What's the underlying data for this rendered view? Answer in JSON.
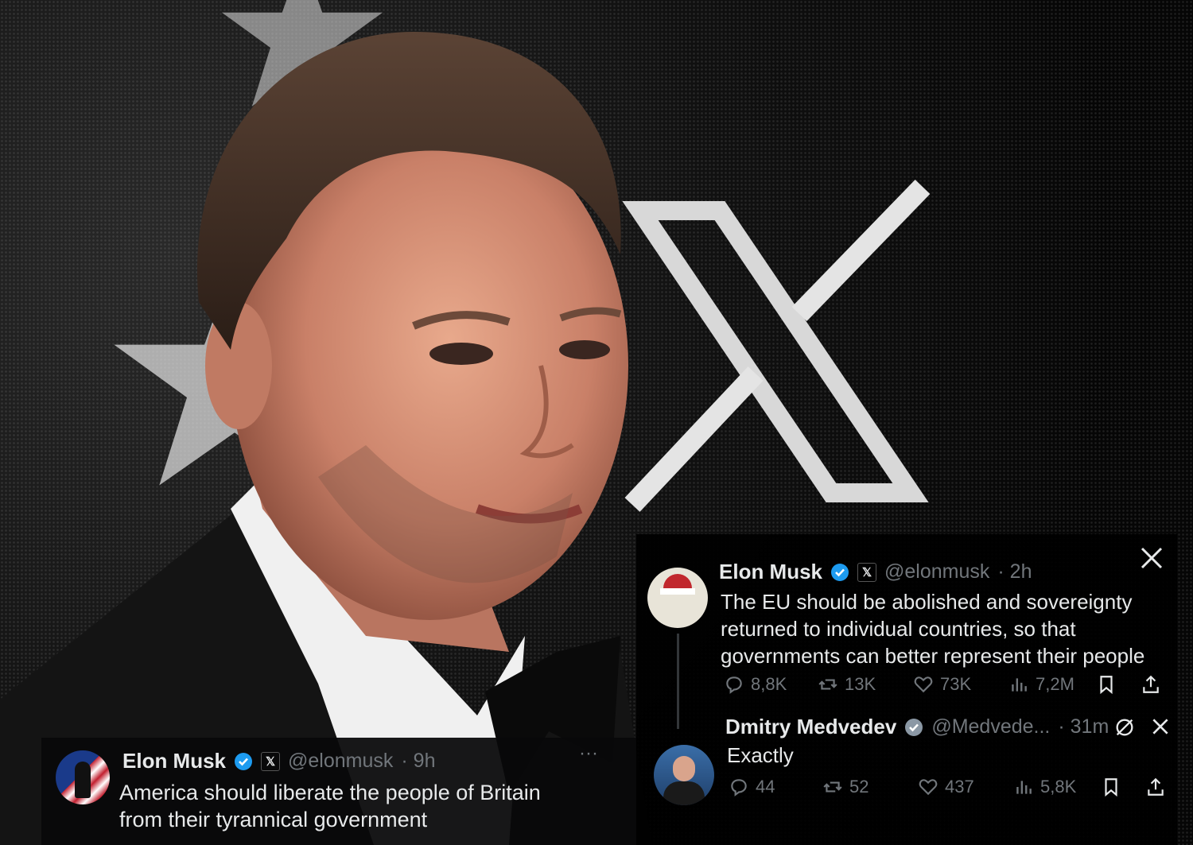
{
  "background": {
    "logo_icon": "x-logo-icon",
    "decor_icon": "star-icon"
  },
  "tweet_bottom": {
    "name": "Elon Musk",
    "handle": "@elonmusk",
    "time": "· 9h",
    "more": "···",
    "text_line1": "America should liberate the people of Britain",
    "text_line2": "from their tyrannical government"
  },
  "tweet_main": {
    "name": "Elon Musk",
    "handle": "@elonmusk",
    "time": "· 2h",
    "text_line1": "The EU should be abolished and sovereignty",
    "text_line2": "returned to individual countries, so that",
    "text_line3": "governments can better represent their people",
    "replies": "8,8K",
    "retweets": "13K",
    "likes": "73K",
    "views": "7,2M"
  },
  "tweet_reply": {
    "name": "Dmitry Medvedev",
    "handle": "@Medvede...",
    "time": "· 31m",
    "text": "Exactly",
    "replies": "44",
    "retweets": "52",
    "likes": "437",
    "views": "5,8K"
  },
  "colors": {
    "x_blue": "#1d9bf0",
    "muted": "#71767b",
    "text": "#e7e9ea"
  }
}
